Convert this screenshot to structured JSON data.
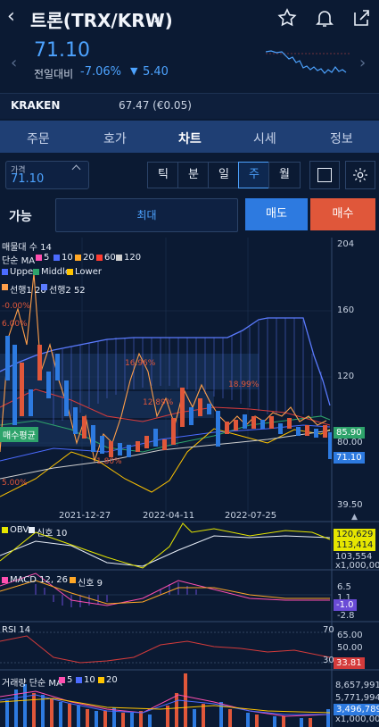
{
  "header": {
    "title": "트론(TRX/KRW)",
    "back_icon": "chevron-left-icon",
    "icons": [
      "star-icon",
      "bell-icon",
      "share-icon"
    ]
  },
  "quote": {
    "price": "71.10",
    "change_label": "전일대비",
    "change_pct": "-7.06%",
    "change_arrow": "▼",
    "change_amount": "5.40"
  },
  "exchange": {
    "name": "KRAKEN",
    "price": "67.47 (€0.05)"
  },
  "tabs": [
    {
      "label": "주문"
    },
    {
      "label": "호가"
    },
    {
      "label": "차트"
    },
    {
      "label": "시세"
    },
    {
      "label": "정보"
    }
  ],
  "active_tab": 2,
  "controls": {
    "price_label": "가격",
    "price_value": "71.10",
    "periods": [
      "틱",
      "분",
      "일",
      "주",
      "월"
    ],
    "active_period": 3,
    "available_label": "가능",
    "max_label": "최대",
    "sell_label": "매도",
    "buy_label": "매수"
  },
  "chart": {
    "main_legend_line1": "매물대 수 14",
    "ma_label": "단순 MA",
    "ma_periods": [
      "5",
      "10",
      "20",
      "60",
      "120"
    ],
    "ma_colors": [
      "#ff4fb0",
      "#4b6bff",
      "#ffa726",
      "#ff3b30",
      "#cfcfcf"
    ],
    "ichimoku_upper": "Upper",
    "ichimoku_middle": "Middle",
    "ichimoku_lower": "Lower",
    "span_legend_1": "선행1 26",
    "span_legend_2": "선행2 52",
    "y_ticks": [
      "204",
      "160",
      "120",
      "80.00",
      "39.50"
    ],
    "price_tag_1": "85.90",
    "price_tag_2": "71.10",
    "avg_tag": "매수평균",
    "x_ticks": [
      "2021-12-27",
      "2022-04-11",
      "2022-07-25"
    ],
    "pct_labels": [
      "12.89%",
      "18.99%",
      "16.96%",
      "1.80%",
      "-0.00%",
      "6.00%",
      "5.00%"
    ],
    "obv": {
      "label": "OBV",
      "signal": "신호 10",
      "values": [
        "120,629",
        "113,414",
        "103,554",
        "x1,000,000"
      ]
    },
    "macd": {
      "label": "MACD 12, 26",
      "signal": "신호 9",
      "values": [
        "6.5",
        "1.1",
        "-1.0",
        "-2.8"
      ]
    },
    "rsi": {
      "label": "RSI 14",
      "levels": [
        "70",
        "30"
      ],
      "values": [
        "65.00",
        "50.00",
        "33.81"
      ]
    },
    "volume": {
      "label": "거래량 단순 MA",
      "periods": [
        "5",
        "10",
        "20"
      ],
      "values": [
        "8,657,991",
        "5,771,994",
        "3,496,789",
        "x1,000,000"
      ]
    }
  }
}
